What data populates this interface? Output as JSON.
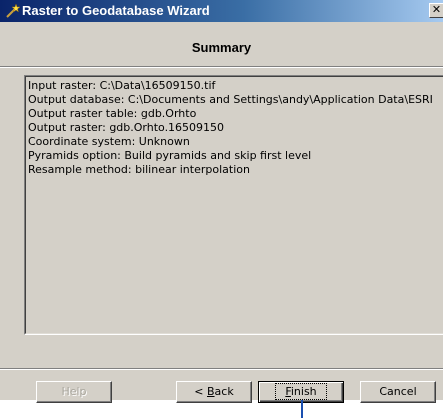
{
  "window": {
    "title": "Raster to Geodatabase Wizard",
    "close_glyph": "✕"
  },
  "page": {
    "heading": "Summary"
  },
  "summary": {
    "lines": [
      "Input raster:  C:\\Data\\16509150.tif",
      "Output database:  C:\\Documents and Settings\\andy\\Application Data\\ESRI",
      "Output raster table:  gdb.Orhto",
      "Output raster:  gdb.Orhto.16509150",
      "Coordinate system:  Unknown",
      "Pyramids option:  Build pyramids and skip first level",
      "Resample method:  bilinear interpolation"
    ]
  },
  "buttons": {
    "help": "Help",
    "back_prefix": "< ",
    "back_mnemonic": "B",
    "back_rest": "ack",
    "finish_mnemonic": "F",
    "finish_rest": "inish",
    "cancel": "Cancel"
  },
  "colors": {
    "dialog_bg": "#d4d0c8",
    "titlebar_start": "#0a246a",
    "titlebar_end": "#a6caf0",
    "pointer": "#1a4fb0"
  },
  "icons": {
    "title_icon": "wizard-wand-icon"
  }
}
